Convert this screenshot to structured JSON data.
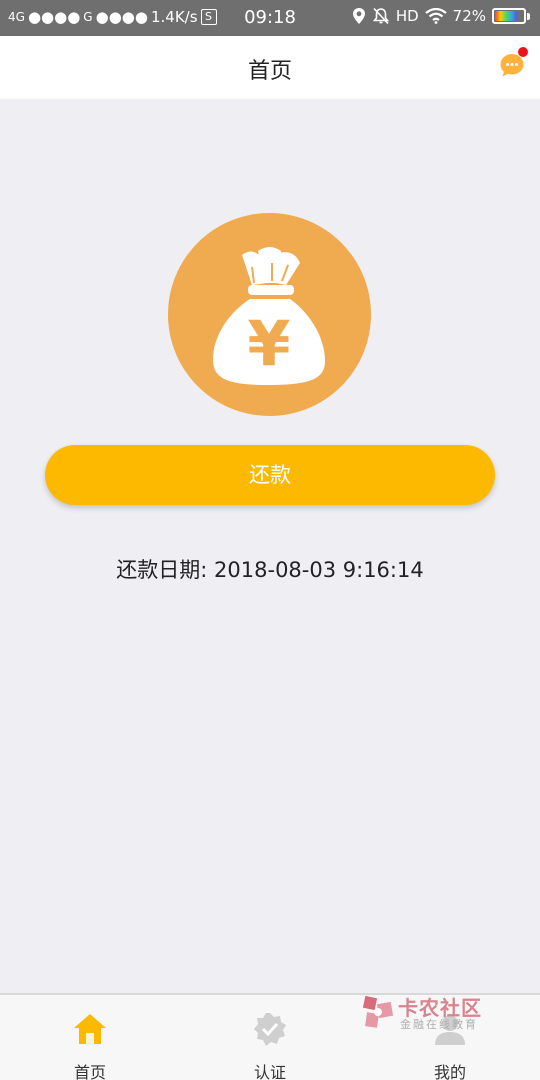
{
  "status_bar": {
    "signal1": "4G",
    "signal2": "G",
    "speed": "1.4K/s",
    "sim_icon": "S",
    "time": "09:18",
    "hd": "HD",
    "battery_percent": "72%",
    "battery_level": 0.72
  },
  "header": {
    "title": "首页",
    "message_icon": "chat-bubble-icon",
    "has_notification": true
  },
  "main": {
    "illustration_icon": "money-bag-yen-icon",
    "repay_button_label": "还款",
    "due_date_label": "还款日期:",
    "due_date_value": "2018-08-03 9:16:14"
  },
  "tabs": [
    {
      "label": "首页",
      "icon": "home-icon",
      "active": true
    },
    {
      "label": "认证",
      "icon": "verified-badge-icon",
      "active": false
    },
    {
      "label": "我的",
      "icon": "user-icon",
      "active": false
    }
  ],
  "watermark": {
    "title": "卡农社区",
    "subtitle": "金融在线教育"
  },
  "colors": {
    "accent": "#fdb900",
    "circle": "#f0aa4f",
    "status_bar": "#6f6f6f",
    "background": "#efeef3"
  }
}
